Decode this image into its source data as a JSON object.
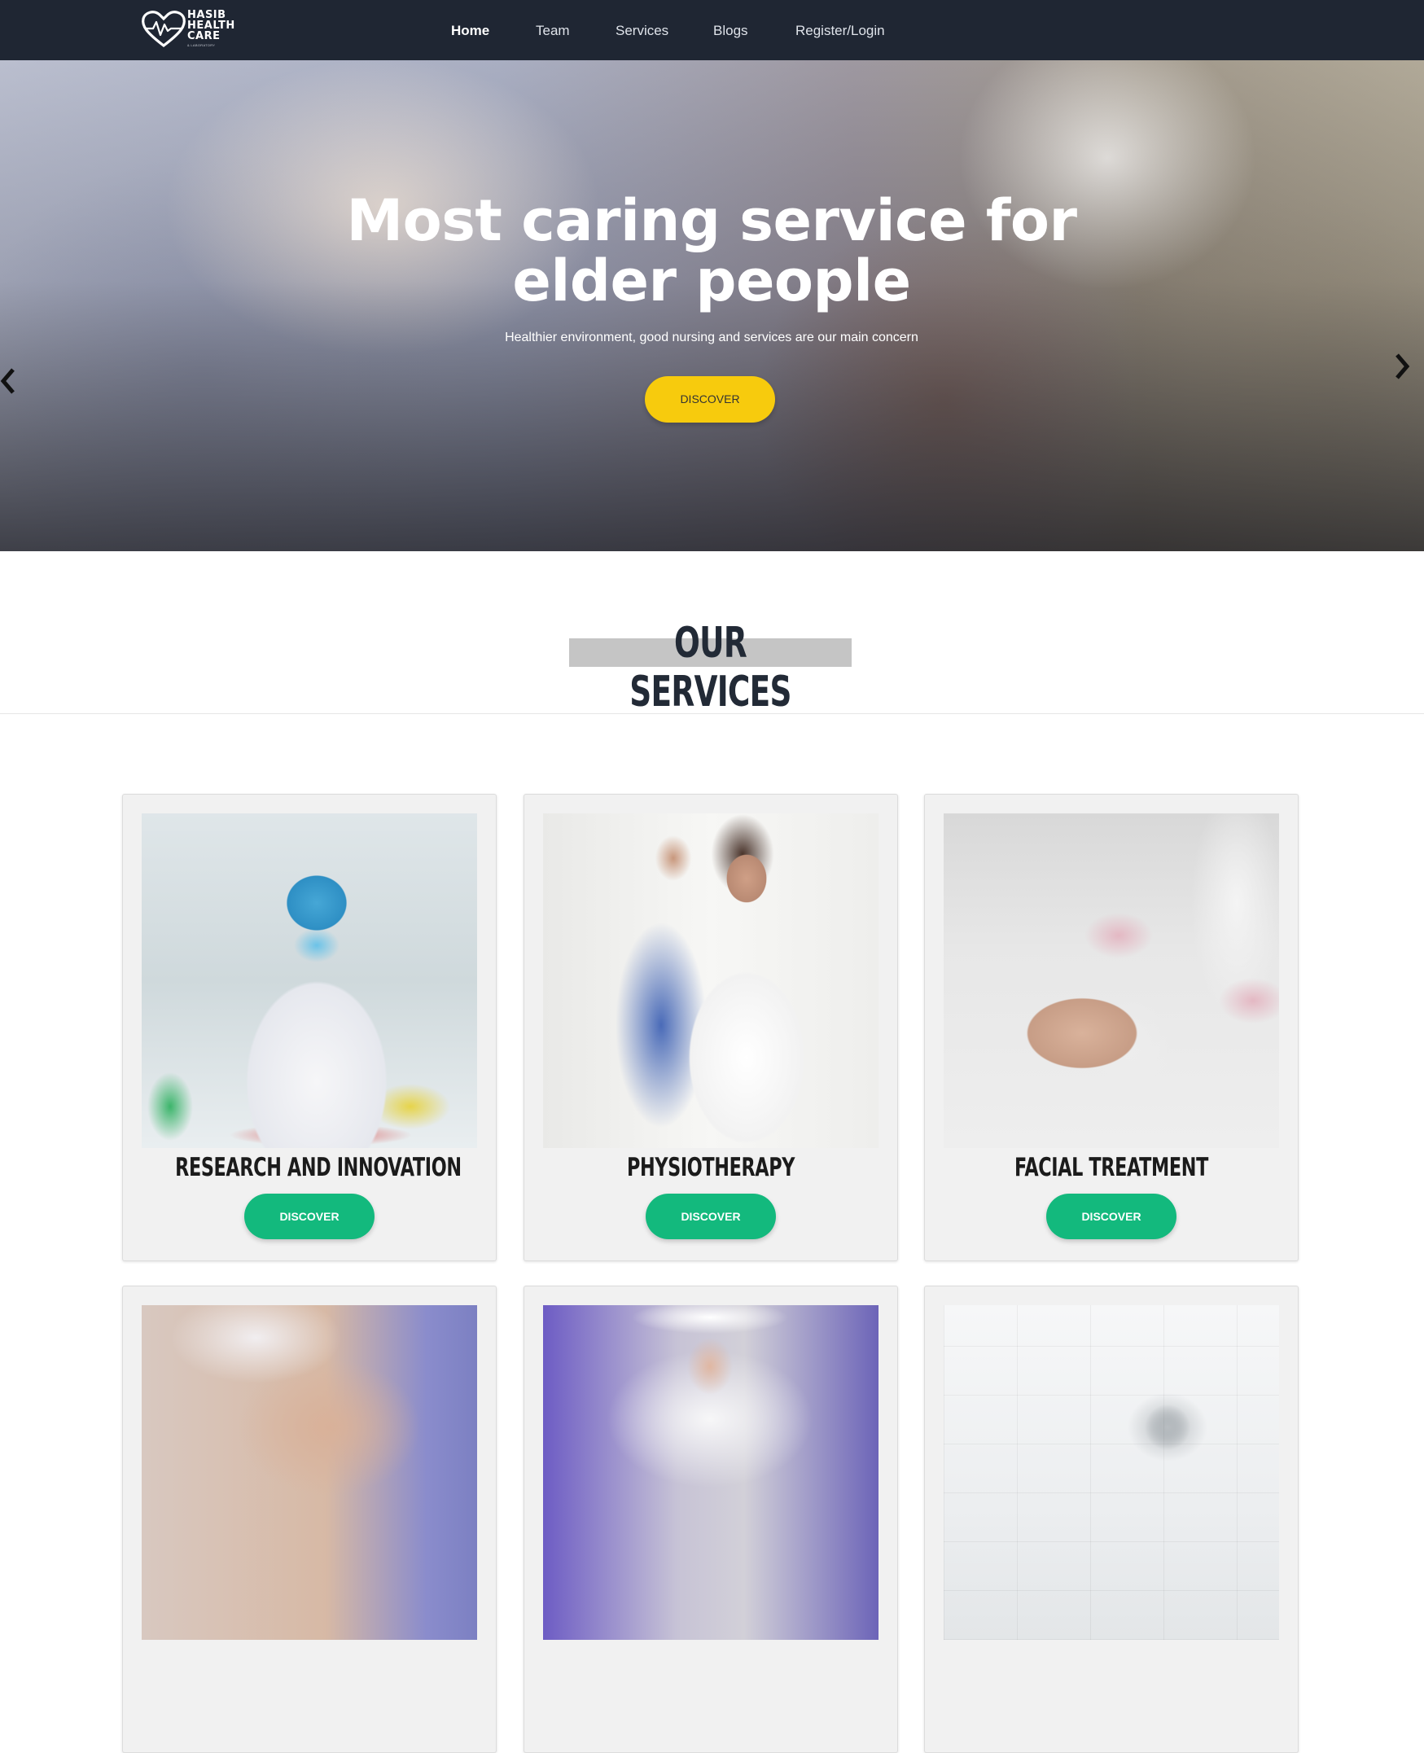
{
  "brand": {
    "logo_lines": [
      "HASIB",
      "HEALTH",
      "CARE"
    ],
    "logo_subtext": "& LABORATORY"
  },
  "nav": {
    "items": [
      {
        "label": "Home",
        "active": true
      },
      {
        "label": "Team",
        "active": false
      },
      {
        "label": "Services",
        "active": false
      },
      {
        "label": "Blogs",
        "active": false
      },
      {
        "label": "Register/Login",
        "active": false
      }
    ]
  },
  "hero": {
    "title_line1": "Most caring service for",
    "title_line2": "elder people",
    "subtitle": "Healthier environment, good nursing and services are our main concern",
    "button_label": "DISCOVER",
    "prev_icon": "chevron-left-icon",
    "next_icon": "chevron-right-icon"
  },
  "services": {
    "heading": "OUR SERVICES",
    "cards": [
      {
        "title": "RESEARCH AND INNOVATION",
        "button_label": "DISCOVER",
        "image": "lab-researcher-image"
      },
      {
        "title": "PHYSIOTHERAPY",
        "button_label": "DISCOVER",
        "image": "physiotherapy-image"
      },
      {
        "title": "FACIAL TREATMENT",
        "button_label": "DISCOVER",
        "image": "facial-treatment-image"
      },
      {
        "title": "",
        "button_label": "",
        "image": "skin-care-image"
      },
      {
        "title": "",
        "button_label": "",
        "image": "doctor-image"
      },
      {
        "title": "",
        "button_label": "",
        "image": "surgery-room-image"
      }
    ]
  },
  "colors": {
    "navbar": "#1f2633",
    "hero_button": "#f7cb0d",
    "card_button": "#13b97d",
    "heading_underline": "#c5c5c5",
    "card_background": "#f1f1f1"
  }
}
